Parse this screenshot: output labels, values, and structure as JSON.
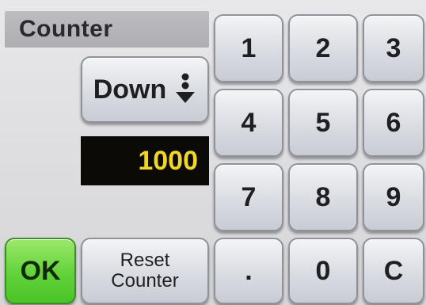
{
  "title": "Counter",
  "mode": {
    "label": "Down",
    "icon": "count-down-icon"
  },
  "display": {
    "value": "1000",
    "text_color": "#f1d62a",
    "background": "#0c0a06"
  },
  "keypad": {
    "keys": [
      "1",
      "2",
      "3",
      "4",
      "5",
      "6",
      "7",
      "8",
      "9",
      ".",
      "0",
      "C"
    ]
  },
  "ok_button": {
    "label": "OK",
    "color": "#63d23a"
  },
  "reset_button": {
    "line1": "Reset",
    "line2": "Counter"
  }
}
